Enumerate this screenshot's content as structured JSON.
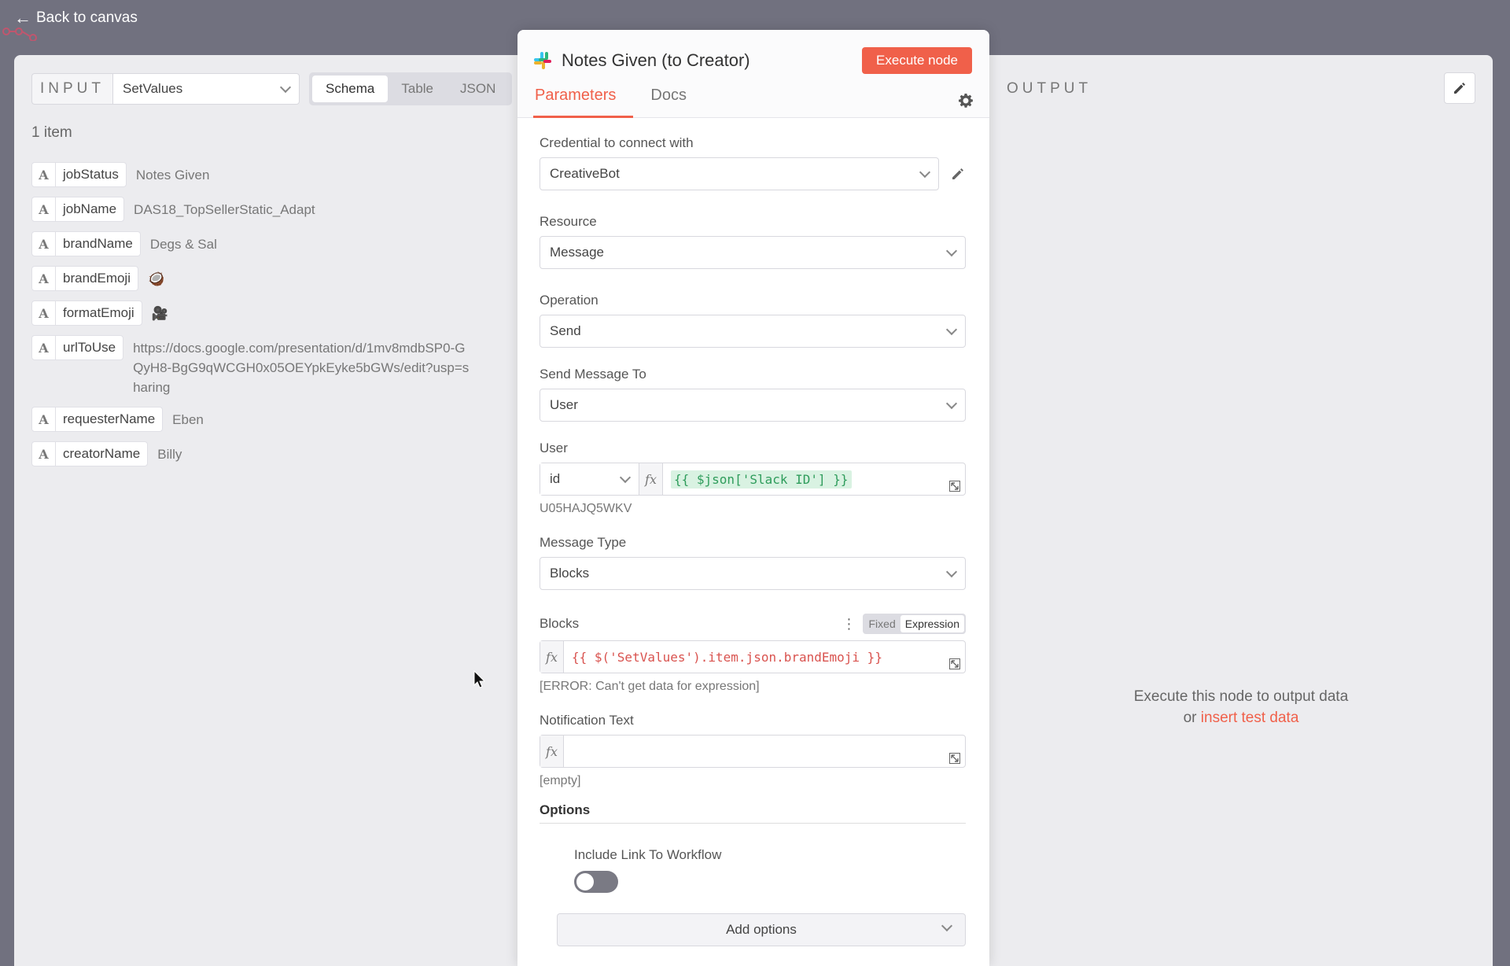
{
  "back_link": "Back to canvas",
  "input": {
    "label": "INPUT",
    "source": "SetValues",
    "view_tabs": [
      "Schema",
      "Table",
      "JSON"
    ],
    "active_view": "Schema",
    "item_count": "1 item",
    "fields": [
      {
        "type": "A",
        "key": "jobStatus",
        "value": "Notes Given"
      },
      {
        "type": "A",
        "key": "jobName",
        "value": "DAS18_TopSellerStatic_Adapt"
      },
      {
        "type": "A",
        "key": "brandName",
        "value": "Degs & Sal"
      },
      {
        "type": "A",
        "key": "brandEmoji",
        "value": "🥥"
      },
      {
        "type": "A",
        "key": "formatEmoji",
        "value": "🎥"
      },
      {
        "type": "A",
        "key": "urlToUse",
        "value": "https://docs.google.com/presentation/d/1mv8mdbSP0-GQyH8-BgG9qWCGH0x05OEYpkEyke5bGWs/edit?usp=sharing"
      },
      {
        "type": "A",
        "key": "requesterName",
        "value": "Eben"
      },
      {
        "type": "A",
        "key": "creatorName",
        "value": "Billy"
      }
    ]
  },
  "node": {
    "title": "Notes Given (to Creator)",
    "execute_label": "Execute node",
    "tabs": [
      "Parameters",
      "Docs"
    ],
    "credential": {
      "label": "Credential to connect with",
      "value": "CreativeBot"
    },
    "resource": {
      "label": "Resource",
      "value": "Message"
    },
    "operation": {
      "label": "Operation",
      "value": "Send"
    },
    "send_to": {
      "label": "Send Message To",
      "value": "User"
    },
    "user": {
      "label": "User",
      "mode": "id",
      "expression": "{{ $json['Slack ID'] }}",
      "result": "U05HAJQ5WKV"
    },
    "message_type": {
      "label": "Message Type",
      "value": "Blocks"
    },
    "blocks": {
      "label": "Blocks",
      "fixed": "Fixed",
      "expression_label": "Expression",
      "expression": "{{ $('SetValues').item.json.brandEmoji }}",
      "result": "[ERROR: Can't get data for expression]"
    },
    "notification": {
      "label": "Notification Text",
      "result": "[empty]"
    },
    "fx": "fx",
    "options": {
      "title": "Options",
      "include_link_label": "Include Link To Workflow",
      "include_link_on": false,
      "add_options_label": "Add options"
    }
  },
  "output": {
    "label": "OUTPUT",
    "empty_text": "Execute this node to output data",
    "or_text": "or",
    "insert_link": "insert test data"
  },
  "colors": {
    "accent": "#f0604a",
    "overlay": "#71717f"
  }
}
